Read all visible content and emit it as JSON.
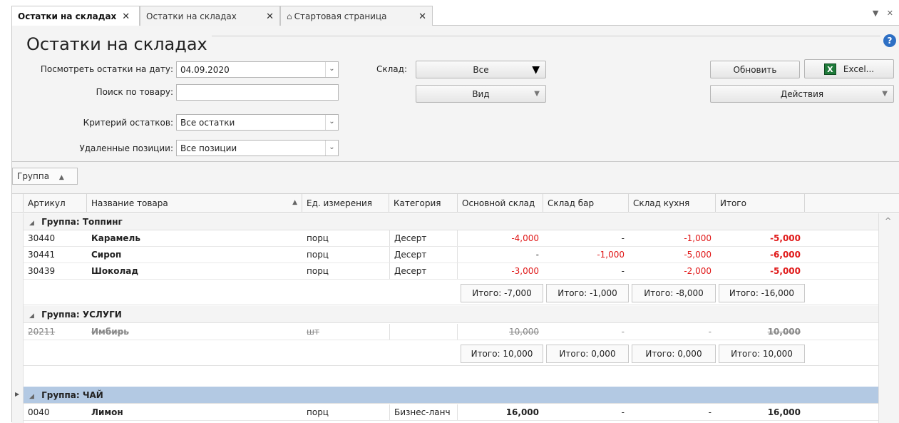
{
  "tabs": [
    {
      "label": "Остатки на складах",
      "active": true
    },
    {
      "label": "Остатки на складах",
      "active": false
    },
    {
      "label": "Стартовая страница",
      "active": false
    }
  ],
  "tab_close": "✕",
  "tab_controls": {
    "menu": "▼",
    "close": "✕"
  },
  "page": {
    "title": "Остатки на складах",
    "help": "?"
  },
  "filters": {
    "date_label": "Посмотреть остатки на дату:",
    "date_value": "04.09.2020",
    "search_label": "Поиск по товару:",
    "search_value": "",
    "criteria_label": "Критерий остатков:",
    "criteria_value": "Все остатки",
    "deleted_label": "Удаленные позиции:",
    "deleted_value": "Все позиции",
    "warehouse_label": "Склад:",
    "warehouse_value": "Все",
    "view_label": "Вид"
  },
  "buttons": {
    "refresh": "Обновить",
    "excel": "Excel...",
    "excel_icon": "X",
    "actions": "Действия"
  },
  "grouping": {
    "chip": "Группа"
  },
  "columns": [
    "Артикул",
    "Название товара",
    "Ед. измерения",
    "Категория",
    "Основной склад",
    "Склад бар",
    "Склад кухня",
    "Итого"
  ],
  "groups": [
    {
      "name": "Группа: Топпинг",
      "rows": [
        {
          "code": "30440",
          "name": "Карамель",
          "unit": "порц",
          "category": "Десерт",
          "main": "-4,000",
          "bar": "-",
          "kitchen": "-1,000",
          "total": "-5,000"
        },
        {
          "code": "30441",
          "name": "Сироп",
          "unit": "порц",
          "category": "Десерт",
          "main": "-",
          "bar": "-1,000",
          "kitchen": "-5,000",
          "total": "-6,000"
        },
        {
          "code": "30439",
          "name": "Шоколад",
          "unit": "порц",
          "category": "Десерт",
          "main": "-3,000",
          "bar": "-",
          "kitchen": "-2,000",
          "total": "-5,000"
        }
      ],
      "totals": {
        "main": "Итого: -7,000",
        "bar": "Итого: -1,000",
        "kitchen": "Итого: -8,000",
        "total": "Итого: -16,000"
      }
    },
    {
      "name": "Группа: УСЛУГИ",
      "rows": [
        {
          "code": "20211",
          "name": "Имбирь",
          "unit": "шт",
          "category": "",
          "main": "10,000",
          "bar": "-",
          "kitchen": "-",
          "total": "10,000"
        }
      ],
      "totals": {
        "main": "Итого: 10,000",
        "bar": "Итого: 0,000",
        "kitchen": "Итого: 0,000",
        "total": "Итого: 10,000"
      }
    },
    {
      "name": "Группа: ЧАЙ",
      "rows": [
        {
          "code": "0040",
          "name": "Лимон",
          "unit": "порц",
          "category": "Бизнес-ланч",
          "main": "16,000",
          "bar": "-",
          "kitchen": "-",
          "total": "16,000"
        }
      ]
    }
  ],
  "colors": {
    "negative": "#e01818",
    "selected_group": "#b3c9e3",
    "help": "#2d6fc4",
    "excel": "#1f7a3a"
  }
}
